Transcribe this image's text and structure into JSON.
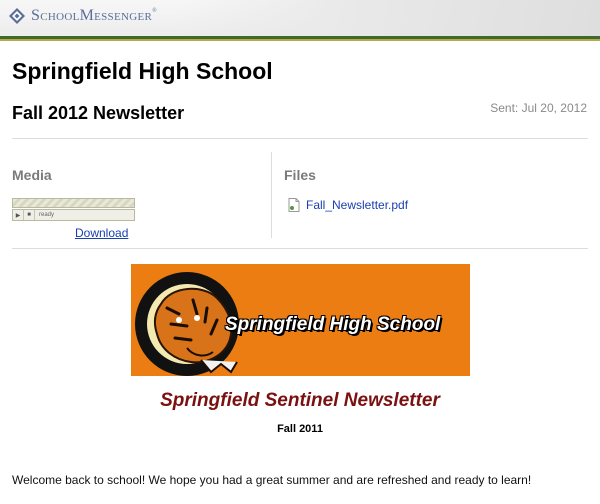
{
  "brand": {
    "name": "SchoolMessenger",
    "reg": "®"
  },
  "message": {
    "school": "Springfield High School",
    "title": "Fall 2012 Newsletter",
    "sent": "Sent: Jul 20, 2012"
  },
  "media": {
    "label": "Media",
    "player_status": "ready",
    "download_label": "Download"
  },
  "files": {
    "label": "Files",
    "items": [
      {
        "name": "Fall_Newsletter.pdf"
      }
    ]
  },
  "body": {
    "banner_text": "Springfield High School",
    "newsletter_name": "Springfield Sentinel Newsletter",
    "issue": "Fall 2011",
    "welcome": "Welcome back to school! We hope you had a great summer and are refreshed and ready to learn!"
  },
  "colors": {
    "brand_blue": "#5b6e98",
    "header_green": "#3d6b2d",
    "banner_orange": "#ec7d12",
    "sentinel_red": "#7a1010",
    "link_blue": "#1a3fb0"
  },
  "icons": {
    "brand_logo": "diamond-logo-icon",
    "file": "pdf-file-icon",
    "player_play": "play-icon",
    "player_stop": "stop-icon",
    "mascot": "tiger-mascot"
  }
}
